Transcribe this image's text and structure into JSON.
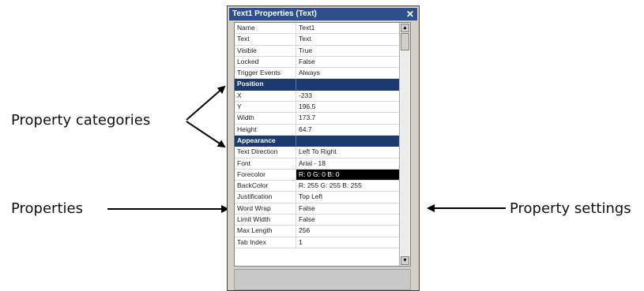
{
  "window": {
    "title": "Text1 Properties (Text)",
    "close_glyph": "✕"
  },
  "rows": [
    {
      "name": "Name",
      "value": "Text1",
      "type": "prop"
    },
    {
      "name": "Text",
      "value": "Text",
      "type": "prop"
    },
    {
      "name": "Visible",
      "value": "True",
      "type": "prop"
    },
    {
      "name": "Locked",
      "value": "False",
      "type": "prop"
    },
    {
      "name": "Trigger Events",
      "value": "Always",
      "type": "prop"
    },
    {
      "name": "Position",
      "value": "",
      "type": "category"
    },
    {
      "name": "X",
      "value": "-233",
      "type": "prop"
    },
    {
      "name": "Y",
      "value": "196.5",
      "type": "prop"
    },
    {
      "name": "Width",
      "value": "173.7",
      "type": "prop"
    },
    {
      "name": "Height",
      "value": "64.7",
      "type": "prop"
    },
    {
      "name": "Appearance",
      "value": "",
      "type": "category"
    },
    {
      "name": "Text Direction",
      "value": "Left To Right",
      "type": "prop"
    },
    {
      "name": "Font",
      "value": "Arial - 18",
      "type": "prop"
    },
    {
      "name": "Forecolor",
      "value": "R: 0 G: 0 B: 0",
      "type": "prop",
      "dark": true
    },
    {
      "name": "BackColor",
      "value": "R: 255 G: 255 B: 255",
      "type": "prop"
    },
    {
      "name": "Justification",
      "value": "Top Left",
      "type": "prop"
    },
    {
      "name": "Word Wrap",
      "value": "False",
      "type": "prop"
    },
    {
      "name": "Limit Width",
      "value": "False",
      "type": "prop"
    },
    {
      "name": "Max Length",
      "value": "256",
      "type": "prop"
    },
    {
      "name": "Tab Index",
      "value": "1",
      "type": "prop"
    }
  ],
  "annotations": {
    "categories": "Property categories",
    "properties": "Properties",
    "settings": "Property settings"
  },
  "colors": {
    "titlebar": "#2d4f8c",
    "category_row": "#1d3a6e"
  }
}
